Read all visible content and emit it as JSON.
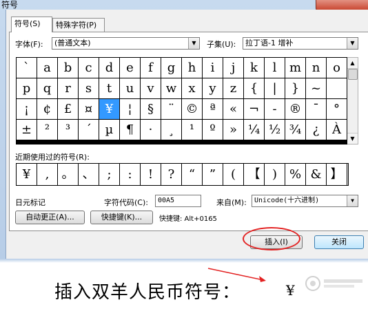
{
  "window": {
    "title": "符号"
  },
  "tabs": [
    {
      "label": "符号(S)"
    },
    {
      "label": "特殊字符(P)"
    }
  ],
  "font": {
    "label": "字体(F):",
    "value": "(普通文本)"
  },
  "subset": {
    "label": "子集(U):",
    "value": "拉丁语-1 增补"
  },
  "symbols": [
    "`",
    "a",
    "b",
    "c",
    "d",
    "e",
    "f",
    "g",
    "h",
    "i",
    "j",
    "k",
    "l",
    "m",
    "n",
    "o",
    "p",
    "q",
    "r",
    "s",
    "t",
    "u",
    "v",
    "w",
    "x",
    "y",
    "z",
    "{",
    "|",
    "}",
    "~",
    " ",
    "¡",
    "¢",
    "£",
    "¤",
    "¥",
    "¦",
    "§",
    "¨",
    "©",
    "ª",
    "«",
    "¬",
    "-",
    "®",
    "¯",
    "°",
    "±",
    "²",
    "³",
    "´",
    "µ",
    "¶",
    "·",
    "¸",
    "¹",
    "º",
    "»",
    "¼",
    "½",
    "¾",
    "¿",
    "À"
  ],
  "selected_symbol_index": 36,
  "recent": {
    "label": "近期使用过的符号(R):",
    "symbols": [
      "¥",
      ",",
      "。",
      "、",
      ";",
      ":",
      "!",
      "?",
      "“",
      "”",
      "(",
      "【",
      ")",
      "%",
      "&",
      "】"
    ]
  },
  "char_name": "日元标记",
  "char_code": {
    "label": "字符代码(C):",
    "value": "00A5"
  },
  "from": {
    "label": "来自(M):",
    "value": "Unicode(十六进制)"
  },
  "buttons": {
    "autocorrect": "自动更正(A)...",
    "shortcut_key": "快捷键(K)...",
    "insert": "插入(I)",
    "close": "关闭"
  },
  "shortcut_text": "快捷键: Alt+0165",
  "caption": "插入双羊人民币符号：",
  "inserted_symbol": "¥",
  "colors": {
    "selection": "#3399ff",
    "annotation": "#e32222"
  }
}
